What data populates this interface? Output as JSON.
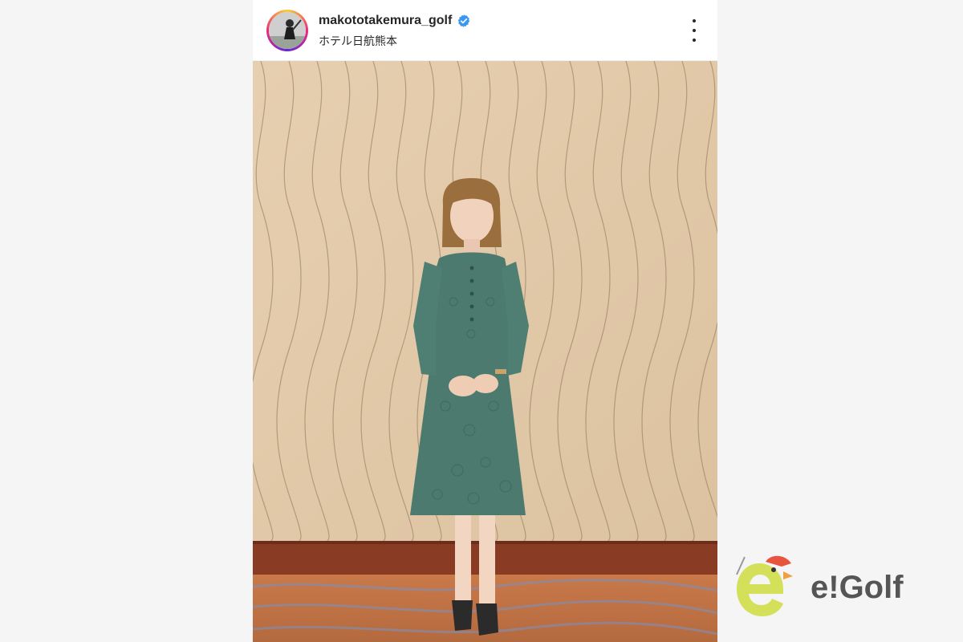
{
  "post": {
    "username": "makototakemura_golf",
    "location": "ホテル日航熊本",
    "verified": true,
    "icons": {
      "verified": "verified-badge-icon",
      "more": "more-options-icon"
    },
    "colors": {
      "verified": "#3897f0",
      "text": "#262626"
    }
  },
  "photo": {
    "subject": "photo-of-woman-in-green-lace-dress"
  },
  "brand": {
    "logo_text": "e!Golf",
    "colors": {
      "mascot": "#d4e05a",
      "cap": "#e8553e",
      "text": "#555555"
    }
  }
}
